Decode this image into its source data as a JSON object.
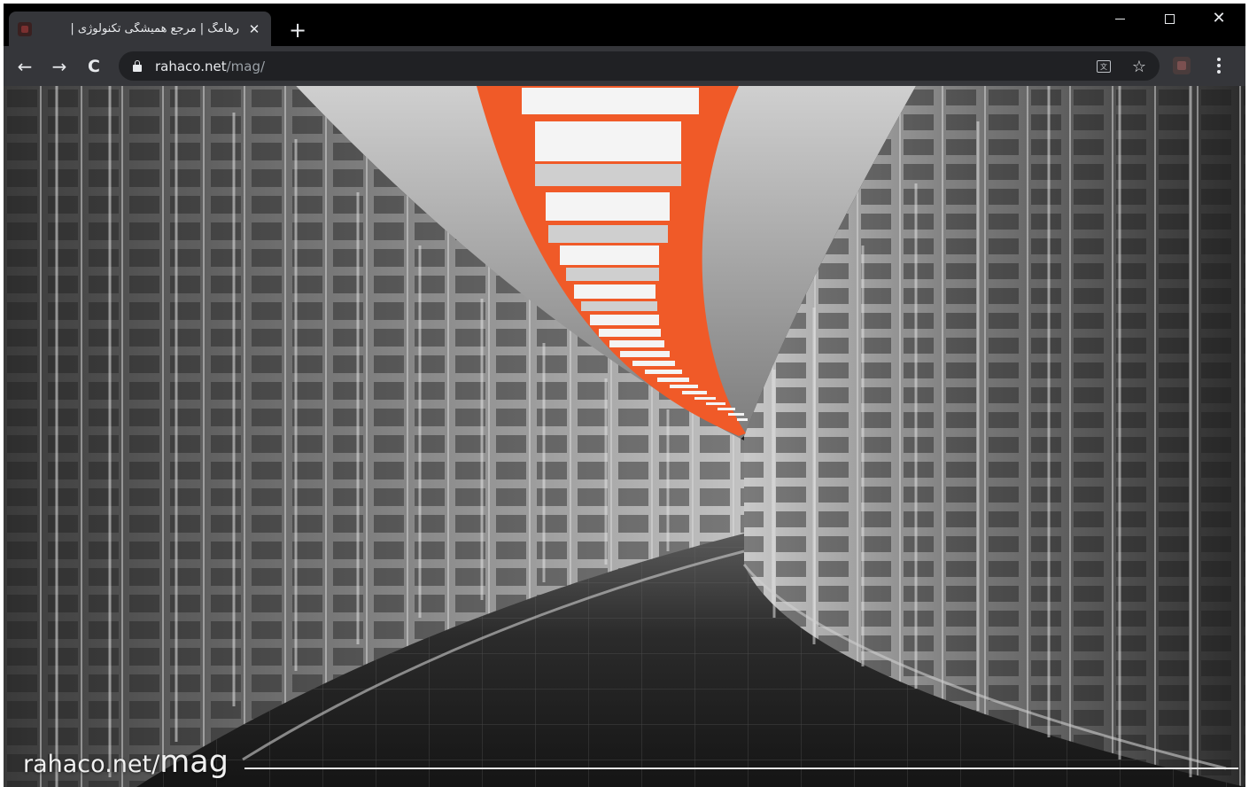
{
  "tab": {
    "title": "رهامگ | مرجع همیشگی تکنولوژی |",
    "close_label": "✕"
  },
  "new_tab_label": "+",
  "window_controls": {
    "close_label": "✕"
  },
  "toolbar": {
    "back_label": "←",
    "forward_label": "→",
    "reload_label": "C",
    "url_host": "rahaco.net",
    "url_path": "/mag/",
    "bookmark_label": "☆"
  },
  "hero": {
    "image_alt": "Curved data center corridor with server racks and orange-lit ceiling",
    "watermark_domain": "rahaco.net",
    "watermark_slash": "/",
    "watermark_mag": "mag"
  },
  "colors": {
    "accent_orange": "#f05a28",
    "titlebar": "#000000",
    "toolbar": "#35363a",
    "omnibox": "#202124"
  }
}
